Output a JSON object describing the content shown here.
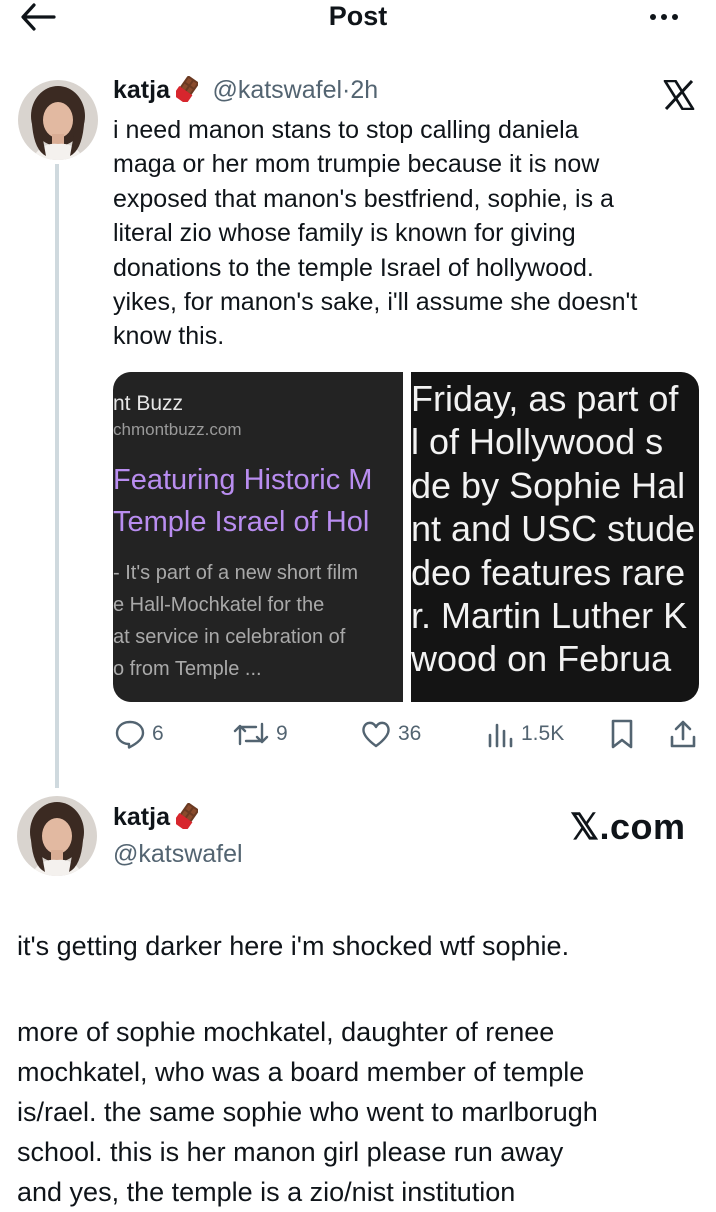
{
  "header": {
    "title": "Post"
  },
  "post": {
    "author_name": "katja",
    "handle": "@katswafel",
    "separator": "·",
    "time": "2h",
    "text_lines": [
      "i need manon stans to stop calling daniela",
      "maga or her mom trumpie because it is now",
      "exposed that manon's bestfriend, sophie, is a",
      "literal zio whose family is known for giving",
      "donations to the temple Israel of hollywood.",
      "yikes, for manon's sake, i'll assume she doesn't",
      "know this."
    ],
    "media_left": {
      "source": "nt Buzz",
      "url": "chmontbuzz.com",
      "headline": [
        "Featuring Historic M",
        "Temple Israel of Hol"
      ],
      "description": [
        "- It's part of a new short film",
        "e Hall-Mochkatel for the",
        "at service in celebration of",
        "o from Temple ..."
      ]
    },
    "media_right": {
      "lines": [
        "Friday, as part of",
        "l of Hollywood s",
        "de by Sophie Hal",
        "nt and USC stude",
        "deo features rare",
        "r. Martin Luther K",
        "wood on Februa"
      ]
    },
    "stats": {
      "replies": "6",
      "reposts": "9",
      "likes": "36",
      "views": "1.5K"
    }
  },
  "card": {
    "author_name": "katja",
    "handle": "@katswafel",
    "brand": "𝕏.com",
    "paragraph1": "it's getting darker here i'm shocked wtf sophie.",
    "paragraph2_lines": [
      "more of sophie mochkatel, daughter of renee",
      "mochkatel, who was a board member of temple",
      "is/rael. the same sophie who went to marlborugh",
      "school. this is her manon girl please run away",
      "and yes, the temple is a zio/nist institution"
    ]
  },
  "colors": {
    "text": "#0f1419",
    "secondary": "#536471",
    "thread": "#cfd9de",
    "link_purple": "#b98df0"
  }
}
